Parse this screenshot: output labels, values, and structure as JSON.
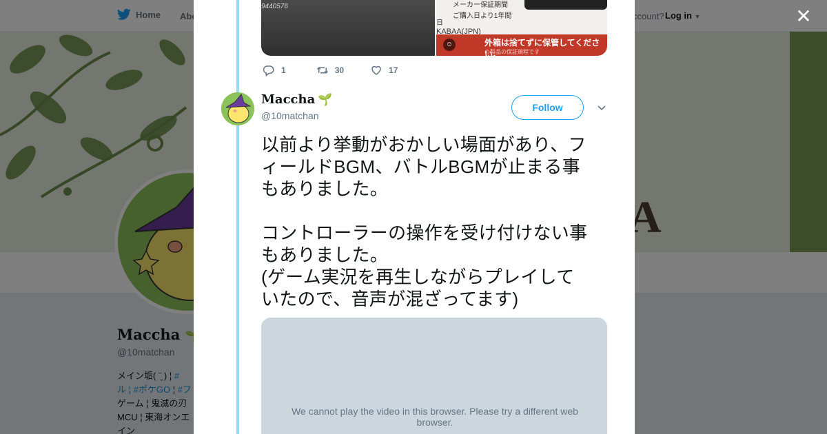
{
  "background_page": {
    "nav": {
      "home_label": "Home",
      "about_label": "Abo",
      "account_prompt": "ccount?",
      "login_label": "Log in"
    },
    "banner_letter": "A",
    "profile": {
      "name": "Maccha",
      "handle": "@10matchan",
      "bio_lines": [
        {
          "text": "メイン垢( ¨̮ ) ¦ ",
          "tag": "#"
        },
        {
          "text": "ル ¦ ",
          "tag": "#ポケGO",
          "text2": " ¦ ",
          "tag2": "#フ"
        },
        {
          "text": "ゲーム ¦ 鬼滅の刃"
        },
        {
          "text": "MCU ¦ 東海オンエ"
        },
        {
          "text": "イン"
        }
      ]
    }
  },
  "modal": {
    "close_icon": "close-icon",
    "previous_tweet": {
      "media_left_caption": "9440576",
      "media_right_lines": [
        "メーカー保証期間",
        "ご購入日より1年間",
        "日",
        "KABAA(JPN)"
      ],
      "media_right_red_text": "外箱は捨てずに保管してください。",
      "media_right_small": "の製品の保証規程です",
      "reply_count": "1",
      "retweet_count": "30",
      "like_count": "17"
    },
    "tweet": {
      "author_name": "Maccha",
      "author_handle": "@10matchan",
      "follow_label": "Follow",
      "paragraph1": [
        "以前より挙動がおかしい場面があり、フ",
        "ィールドBGM、バトルBGMが止まる事",
        "もありました。"
      ],
      "paragraph2": [
        "コントローラーの操作を受け付けない事",
        "もありました。",
        "(ゲーム実況を再生しながらプレイして",
        "いたので、音声が混ざってます)"
      ],
      "video_message": "We cannot play the video in this browser. Please try a different web browser."
    }
  },
  "colors": {
    "accent": "#1da1f2",
    "thread_line": "#9cd7f7",
    "muted_text": "#657786",
    "hashtag": "#1b95e0",
    "banner_green": "#7a9a55"
  }
}
